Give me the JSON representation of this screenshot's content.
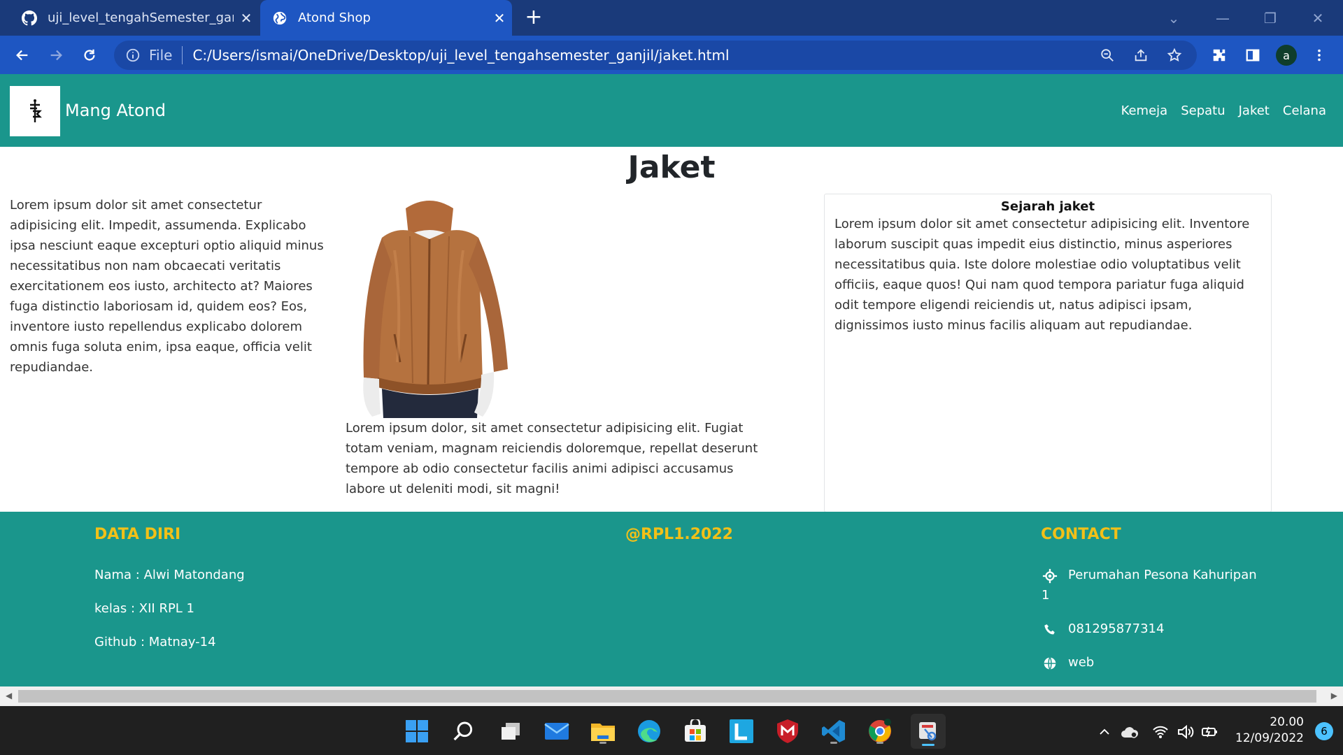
{
  "browser": {
    "tabs": [
      {
        "title": "uji_level_tengahSemester_ganjil/s",
        "icon": "github-icon",
        "active": false
      },
      {
        "title": "Atond Shop",
        "icon": "globe-icon",
        "active": true
      }
    ],
    "close_glyph": "✕",
    "new_tab_glyph": "+",
    "omnibox": {
      "scheme_label": "File",
      "url": "C:/Users/ismai/OneDrive/Desktop/uji_level_tengahsemester_ganjil/jaket.html"
    },
    "profile_initial": "a"
  },
  "site": {
    "logo_icon": "brand-logo-icon",
    "brand": "Mang Atond",
    "menu": [
      "Kemeja",
      "Sepatu",
      "Jaket",
      "Celana"
    ]
  },
  "main": {
    "title": "Jaket",
    "left_text": "Lorem ipsum dolor sit amet consectetur adipisicing elit. Impedit, assumenda. Explicabo ipsa nesciunt eaque excepturi optio aliquid minus necessitatibus non nam obcaecati veritatis exercitationem eos iusto, architecto at? Maiores fuga distinctio laboriosam id, quidem eos? Eos, inventore iusto repellendus explicabo dolorem omnis fuga soluta enim, ipsa eaque, officia velit repudiandae.",
    "image_subject": "brown leather jacket on mannequin",
    "mid_text": "Lorem ipsum dolor, sit amet consectetur adipisicing elit. Fugiat totam veniam, magnam reiciendis doloremque, repellat deserunt tempore ab odio consectetur facilis animi adipisci accusamus labore ut deleniti modi, sit magni!",
    "card": {
      "title": "Sejarah jaket",
      "body": "Lorem ipsum dolor sit amet consectetur adipisicing elit. Inventore laborum suscipit quas impedit eius distinctio, minus asperiores necessitatibus quia. Iste dolore molestiae odio voluptatibus velit officiis, eaque quos! Qui nam quod tempora pariatur fuga aliquid odit tempore eligendi reiciendis ut, natus adipisci ipsam, dignissimos iusto minus facilis aliquam aut repudiandae."
    }
  },
  "footer": {
    "data_diri": {
      "heading": "DATA DIRI",
      "nama": "Nama : Alwi Matondang",
      "kelas": "kelas : XII RPL 1",
      "github": "Github : Matnay-14"
    },
    "center_heading": "@RPL1.2022",
    "contact": {
      "heading": "CONTACT",
      "address_line1": "Perumahan Pesona Kahuripan",
      "address_line2": "1",
      "phone": "081295877314",
      "web": "web"
    }
  },
  "taskbar": {
    "apps": [
      "windows-start-icon",
      "search-icon",
      "task-view-icon",
      "mail-icon",
      "file-explorer-icon",
      "edge-icon",
      "store-icon",
      "l-app-icon",
      "mcafee-icon",
      "vscode-icon",
      "chrome-icon",
      "snipping-tool-icon"
    ],
    "time": "20.00",
    "date": "12/09/2022",
    "notification_count": "6"
  },
  "colors": {
    "tab_strip": "#1a3a7a",
    "toolbar": "#1e56c2",
    "site_teal": "#1a968c",
    "footer_heading": "#f2c018",
    "taskbar": "#202020"
  }
}
